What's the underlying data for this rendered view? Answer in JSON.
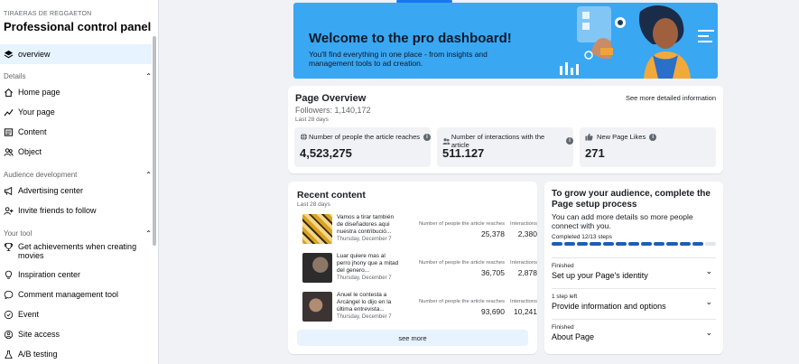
{
  "sidebar": {
    "subtitle": "TIRAERAS DE REGGAETON",
    "title": "Professional control panel",
    "active_item": {
      "label": "overview",
      "icon": "layers-icon"
    },
    "sections": [
      {
        "label": "Details",
        "items": [
          {
            "label": "Home page",
            "icon": "home-icon"
          },
          {
            "label": "Your page",
            "icon": "trend-icon"
          },
          {
            "label": "Content",
            "icon": "content-icon"
          },
          {
            "label": "Object",
            "icon": "people-icon"
          }
        ]
      },
      {
        "label": "Audience development",
        "items": [
          {
            "label": "Advertising center",
            "icon": "megaphone-icon"
          },
          {
            "label": "Invite friends to follow",
            "icon": "invite-icon"
          }
        ]
      },
      {
        "label": "Your tool",
        "items": [
          {
            "label": "Get achievements when creating movies",
            "icon": "trophy-icon"
          },
          {
            "label": "Inspiration center",
            "icon": "bulb-icon"
          },
          {
            "label": "Comment management tool",
            "icon": "comment-icon"
          },
          {
            "label": "Event",
            "icon": "calendar-icon"
          },
          {
            "label": "Site access",
            "icon": "globe-icon"
          },
          {
            "label": "A/B testing",
            "icon": "flask-icon"
          }
        ]
      }
    ]
  },
  "banner": {
    "title": "Welcome to the pro dashboard!",
    "text": "You'll find everything in one place - from insights and management tools to ad creation.",
    "bg_color": "#3aa7f2"
  },
  "overview": {
    "title": "Page Overview",
    "more_link": "See more detailed information",
    "followers": "Followers: 1,140,172",
    "range": "Last 28 days",
    "metrics": [
      {
        "label": "Number of people the article reaches",
        "value": "4,523,275",
        "icon": "globe-icon"
      },
      {
        "label": "Number of interactions with the article",
        "value": "511.127",
        "icon": "people-icon"
      },
      {
        "label": "New Page Likes",
        "value": "271",
        "icon": "thumbs-up-icon"
      }
    ]
  },
  "recent": {
    "title": "Recent content",
    "range": "Last 28 days",
    "reach_label": "Number of people the article reaches",
    "interactions_label": "Interactions",
    "see_more": "see more",
    "posts": [
      {
        "text": "Vamos a tirar también de diseñadores aqui nuestra contribució...",
        "date": "Thursday, December 7",
        "reach": "25,378",
        "interactions": "2,380"
      },
      {
        "text": "Luar quiere mas al perro jhony que a mitad del genero...",
        "date": "Thursday, December 7",
        "reach": "36,705",
        "interactions": "2,878"
      },
      {
        "text": "Anuel le contesta a Arcángel lo dijo en la última entrevista...",
        "date": "Thursday, December 7",
        "reach": "93,690",
        "interactions": "10,241"
      }
    ]
  },
  "setup": {
    "title": "To grow your audience, complete the Page setup process",
    "text": "You can add more details so more people connect with you.",
    "completed": "Completed 12/13 steps",
    "steps_done": 12,
    "steps_total": 13,
    "accent": "#1b5fb8",
    "steps": [
      {
        "status": "Finished",
        "label": "Set up your Page's identity"
      },
      {
        "status": "1 step left",
        "label": "Provide information and options"
      },
      {
        "status": "Finished",
        "label": "About Page"
      }
    ]
  }
}
